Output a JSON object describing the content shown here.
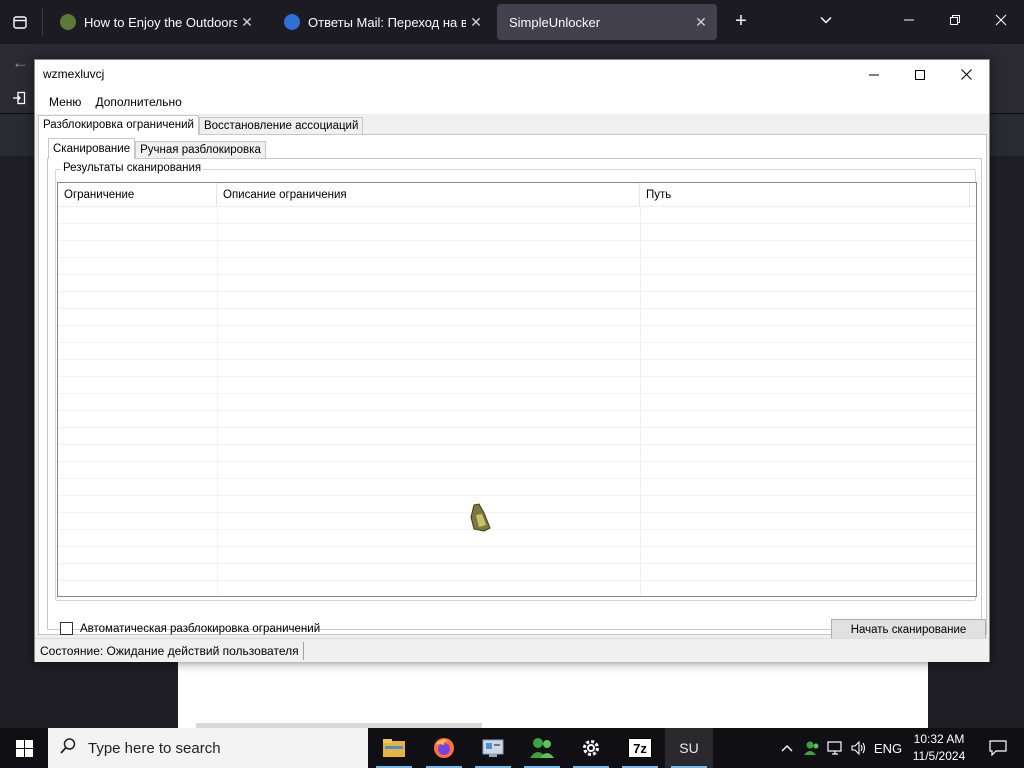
{
  "browser": {
    "tabs": [
      {
        "title": "How to Enjoy the Outdoors (wit",
        "favicon_color": "#5b7a3a",
        "active": false
      },
      {
        "title": "Ответы Mail: Переход на внеш",
        "favicon_color": "#2f6fd6",
        "active": false
      },
      {
        "title": "SimpleUnlocker",
        "favicon_color": "",
        "active": true
      }
    ],
    "close_glyph": "✕",
    "new_tab_glyph": "+",
    "tab_menu_glyph": "⌄"
  },
  "window": {
    "title": "wzmexluvcj",
    "minimize_label": "minimize",
    "maximize_label": "maximize",
    "close_label": "close"
  },
  "menubar": {
    "items": [
      "Меню",
      "Дополнительно"
    ]
  },
  "outer_tabs": [
    {
      "label": "Разблокировка ограничений",
      "selected": true
    },
    {
      "label": "Восстановление ассоциаций",
      "selected": false
    }
  ],
  "inner_tabs": [
    {
      "label": "Сканирование",
      "selected": true
    },
    {
      "label": "Ручная разблокировка",
      "selected": false
    }
  ],
  "scan": {
    "group_label": "Результаты сканирования",
    "columns": [
      "Ограничение",
      "Описание ограничения",
      "Путь"
    ],
    "rows": [],
    "auto_unlock_label": "Автоматическая разблокировка ограничений",
    "auto_unlock_checked": false,
    "start_button": "Начать сканирование"
  },
  "statusbar": {
    "text": "Состояние: Ожидание действий пользователя"
  },
  "taskbar": {
    "search_placeholder": "Type here to search",
    "apps": [
      "file-explorer",
      "firefox",
      "control-panel",
      "people",
      "settings",
      "7zip",
      "simpleunlocker"
    ],
    "su_label": "SU",
    "zip_label": "7z",
    "language": "ENG",
    "time": "10:32 AM",
    "date": "11/5/2024"
  },
  "colors": {
    "browser_bg": "#1c1b22",
    "active_tab": "#42414d",
    "window_bg": "#f0f0f0",
    "taskbar_bg": "#101014",
    "accent": "#76b9ed"
  }
}
